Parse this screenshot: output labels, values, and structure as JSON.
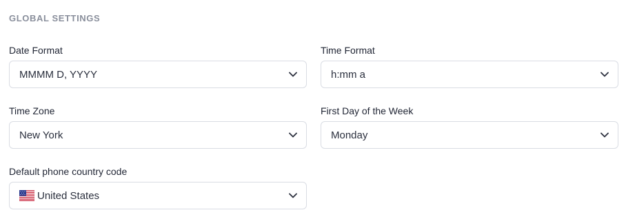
{
  "section": {
    "title": "GLOBAL SETTINGS"
  },
  "fields": {
    "date_format": {
      "label": "Date Format",
      "value": "MMMM D, YYYY"
    },
    "time_format": {
      "label": "Time Format",
      "value": "h:mm a"
    },
    "time_zone": {
      "label": "Time Zone",
      "value": "New York"
    },
    "first_day_of_week": {
      "label": "First Day of the Week",
      "value": "Monday"
    },
    "phone_country_code": {
      "label": "Default phone country code",
      "value": "United States",
      "flag_icon": "us-flag-icon"
    }
  },
  "icons": {
    "chevron": "chevron-down-icon"
  },
  "colors": {
    "section_title": "#8a8f9c",
    "label": "#1f2433",
    "border": "#d9dce3"
  }
}
